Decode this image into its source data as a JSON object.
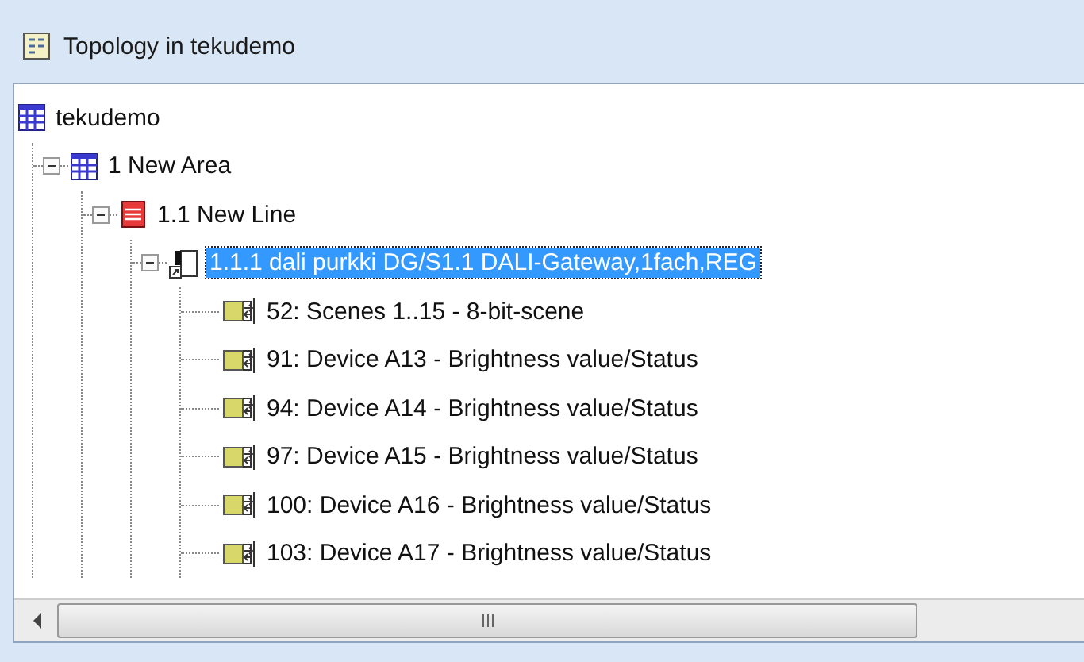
{
  "window": {
    "title": "Topology in tekudemo"
  },
  "tree": [
    {
      "kind": "project",
      "label": "tekudemo",
      "selected": false,
      "children": [
        {
          "kind": "area",
          "label": "1 New Area",
          "expanded": true,
          "selected": false,
          "children": [
            {
              "kind": "line",
              "label": "1.1 New Line",
              "expanded": true,
              "selected": false,
              "children": [
                {
                  "kind": "device",
                  "label": "1.1.1 dali purkki DG/S1.1 DALI-Gateway,1fach,REG",
                  "expanded": true,
                  "selected": true,
                  "children": [
                    {
                      "kind": "object",
                      "label": "52: Scenes 1..15 - 8-bit-scene",
                      "selected": false
                    },
                    {
                      "kind": "object",
                      "label": "91: Device A13 - Brightness value/Status",
                      "selected": false
                    },
                    {
                      "kind": "object",
                      "label": "94: Device A14 - Brightness value/Status",
                      "selected": false
                    },
                    {
                      "kind": "object",
                      "label": "97: Device A15 - Brightness value/Status",
                      "selected": false
                    },
                    {
                      "kind": "object",
                      "label": "100: Device A16 - Brightness value/Status",
                      "selected": false
                    },
                    {
                      "kind": "object",
                      "label": "103: Device A17 - Brightness value/Status",
                      "selected": false
                    }
                  ]
                }
              ]
            }
          ]
        }
      ]
    }
  ]
}
